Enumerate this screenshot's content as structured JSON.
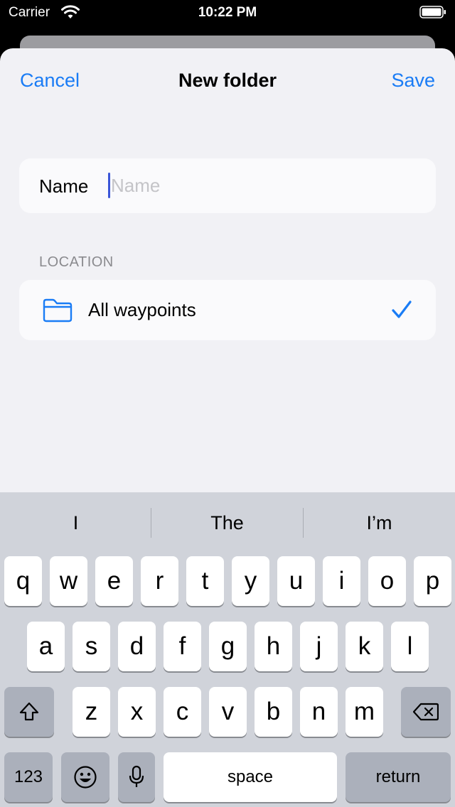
{
  "status_bar": {
    "carrier": "Carrier",
    "time": "10:22 PM"
  },
  "nav": {
    "cancel_label": "Cancel",
    "title": "New folder",
    "save_label": "Save"
  },
  "name_field": {
    "label": "Name",
    "placeholder": "Name",
    "value": ""
  },
  "location": {
    "header": "LOCATION",
    "items": [
      {
        "label": "All waypoints",
        "icon": "folder-icon",
        "selected": true
      }
    ]
  },
  "keyboard": {
    "suggestions": [
      "I",
      "The",
      "I’m"
    ],
    "row1": [
      "q",
      "w",
      "e",
      "r",
      "t",
      "y",
      "u",
      "i",
      "o",
      "p"
    ],
    "row2": [
      "a",
      "s",
      "d",
      "f",
      "g",
      "h",
      "j",
      "k",
      "l"
    ],
    "row3": [
      "z",
      "x",
      "c",
      "v",
      "b",
      "n",
      "m"
    ],
    "numbers_label": "123",
    "space_label": "space",
    "return_label": "return"
  },
  "colors": {
    "accent": "#1a7cf5",
    "sheet_background": "#f1f1f5",
    "keyboard_background": "#d0d3da"
  }
}
